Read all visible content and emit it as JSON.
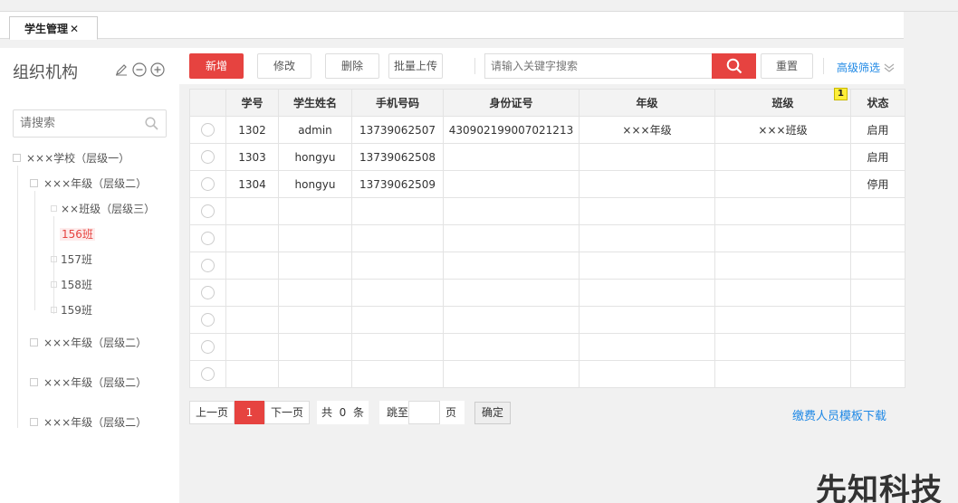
{
  "tab": {
    "label": "学生管理",
    "close": "✕"
  },
  "sidebar": {
    "title": "组织机构",
    "search_placeholder": "请搜索",
    "tree": [
      {
        "label": "×××学校（层级一）"
      },
      {
        "label": "×××年级（层级二）"
      },
      {
        "label": "××班级（层级三）"
      },
      {
        "label": "156班"
      },
      {
        "label": "157班"
      },
      {
        "label": "158班"
      },
      {
        "label": "159班"
      },
      {
        "label": "×××年级（层级二）"
      },
      {
        "label": "×××年级（层级二）"
      },
      {
        "label": "×××年级（层级二）"
      }
    ],
    "selected": "156班"
  },
  "toolbar": {
    "add": "新增",
    "edit": "修改",
    "delete": "删除",
    "batch_upload": "批量上传",
    "keyword_placeholder": "请输入关键字搜索",
    "reset": "重置",
    "advanced": "高级筛选"
  },
  "table": {
    "headers": [
      "学号",
      "学生姓名",
      "手机号码",
      "身份证号",
      "年级",
      "班级",
      "状态"
    ],
    "rows": [
      [
        "1302",
        "admin",
        "13739062507",
        "430902199007021213",
        "×××年级",
        "×××班级",
        "启用"
      ],
      [
        "1303",
        "hongyu",
        "13739062508",
        "",
        "",
        "",
        "启用"
      ],
      [
        "1304",
        "hongyu",
        "13739062509",
        "",
        "",
        "",
        "停用"
      ]
    ],
    "badge": "1"
  },
  "pager": {
    "prev": "上一页",
    "current": "1",
    "next": "下一页",
    "total_prefix": "共",
    "total": "0",
    "total_suffix": "条",
    "jump_prefix": "跳至",
    "jump_suffix": "页",
    "confirm": "确定"
  },
  "download_link": "缴费人员模板下载",
  "watermark": "先知科技",
  "colors": {
    "accent": "#e64340",
    "link": "#1e88e5"
  }
}
